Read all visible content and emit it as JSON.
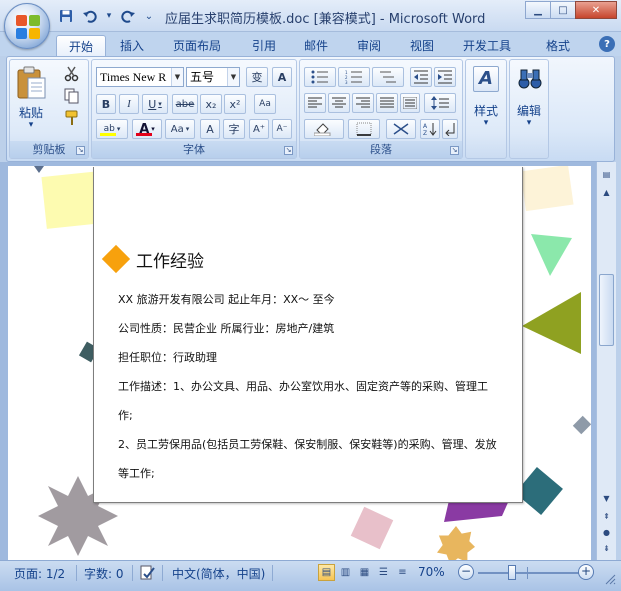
{
  "window": {
    "title": "应届生求职简历模板.doc [兼容模式] - Microsoft Word",
    "buttons": {
      "minimize": "▁",
      "maximize": "□",
      "close": "✕"
    }
  },
  "quick_access": [
    {
      "name": "save-icon",
      "glyph": "💾"
    },
    {
      "name": "undo-icon",
      "glyph": "↶"
    },
    {
      "name": "undo-dropdown-icon",
      "glyph": "▾"
    },
    {
      "name": "redo-icon",
      "glyph": "↻"
    },
    {
      "name": "customize-qat-icon",
      "glyph": "⌄"
    }
  ],
  "tabs": [
    "开始",
    "插入",
    "页面布局",
    "引用",
    "邮件",
    "审阅",
    "视图",
    "开发工具",
    "格式"
  ],
  "help": "?",
  "ribbon": {
    "clipboard": {
      "label": "剪贴板",
      "paste": "粘贴",
      "paste_arrow": "▾"
    },
    "font": {
      "label": "字体",
      "font_name": "Times New R",
      "font_size": "五号",
      "row1": [
        "变",
        "A"
      ],
      "row2": [
        "B",
        "I",
        "U",
        "abe",
        "x₂",
        "x²",
        "Aa"
      ],
      "row3": [
        "ab",
        "A",
        "Aa",
        "A",
        "字",
        "A⁺",
        "A⁻"
      ]
    },
    "paragraph": {
      "label": "段落"
    },
    "styles": {
      "label": "样式"
    },
    "editing": {
      "label": "编辑"
    }
  },
  "document": {
    "section_title": "工作经验",
    "lines": [
      "XX 旅游开发有限公司        起止年月：XX～  至今",
      "公司性质：民营企业      所属行业：房地产/建筑",
      "担任职位：行政助理",
      "工作描述：1、办公文具、用品、办公室饮用水、固定资产等的采购、管理工",
      "作;",
      "2、员工劳保用品(包括员工劳保鞋、保安制服、保安鞋等)的采购、管理、发放",
      "等工作;"
    ]
  },
  "status": {
    "page": "页面: 1/2",
    "words": "字数: 0",
    "language": "中文(简体，中国)",
    "zoom": "70%",
    "zoom_value": 0.7,
    "zoom_minus": "−",
    "zoom_plus": "+"
  },
  "colors": {
    "accent": "#f7a10d",
    "font_color_bar": "#e2001a",
    "highlight_bar": "#ffff00"
  }
}
